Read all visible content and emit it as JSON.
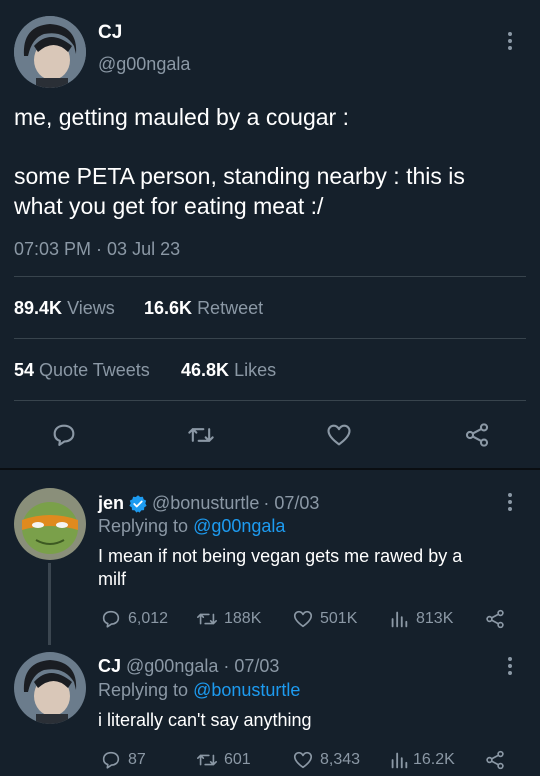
{
  "tweet": {
    "name": "CJ",
    "handle": "@g00ngala",
    "text_line1": "me, getting mauled by a cougar :",
    "text_line2": "some PETA person, standing nearby : this is",
    "text_line3": "what you get for eating meat :/",
    "timestamp": "07:03 PM · 03 Jul 23",
    "views_count": "89.4K",
    "views_label": "Views",
    "retweets_count": "16.6K",
    "retweets_label": "Retweet",
    "quotes_count": "54",
    "quotes_label": "Quote Tweets",
    "likes_count": "46.8K",
    "likes_label": "Likes"
  },
  "reply1": {
    "name": "jen",
    "handle": "@bonusturtle",
    "date": "· 07/03",
    "replying_prefix": "Replying to",
    "replying_to": "@g00ngala",
    "text_line1": "I mean if not being vegan gets me rawed by a",
    "text_line2": "milf",
    "replies": "6,012",
    "retweets": "188K",
    "likes": "501K",
    "views": "813K"
  },
  "reply2": {
    "name": "CJ",
    "handle": "@g00ngala",
    "date": "· 07/03",
    "replying_prefix": "Replying to",
    "replying_to": "@bonusturtle",
    "text_line1": "i literally can't say anything",
    "replies": "87",
    "retweets": "601",
    "likes": "8,343",
    "views": "16.2K"
  },
  "colors": {
    "background": "#15202b",
    "accent": "#1d9bf0",
    "muted": "#8b98a5",
    "verified": "#1d9bf0"
  }
}
